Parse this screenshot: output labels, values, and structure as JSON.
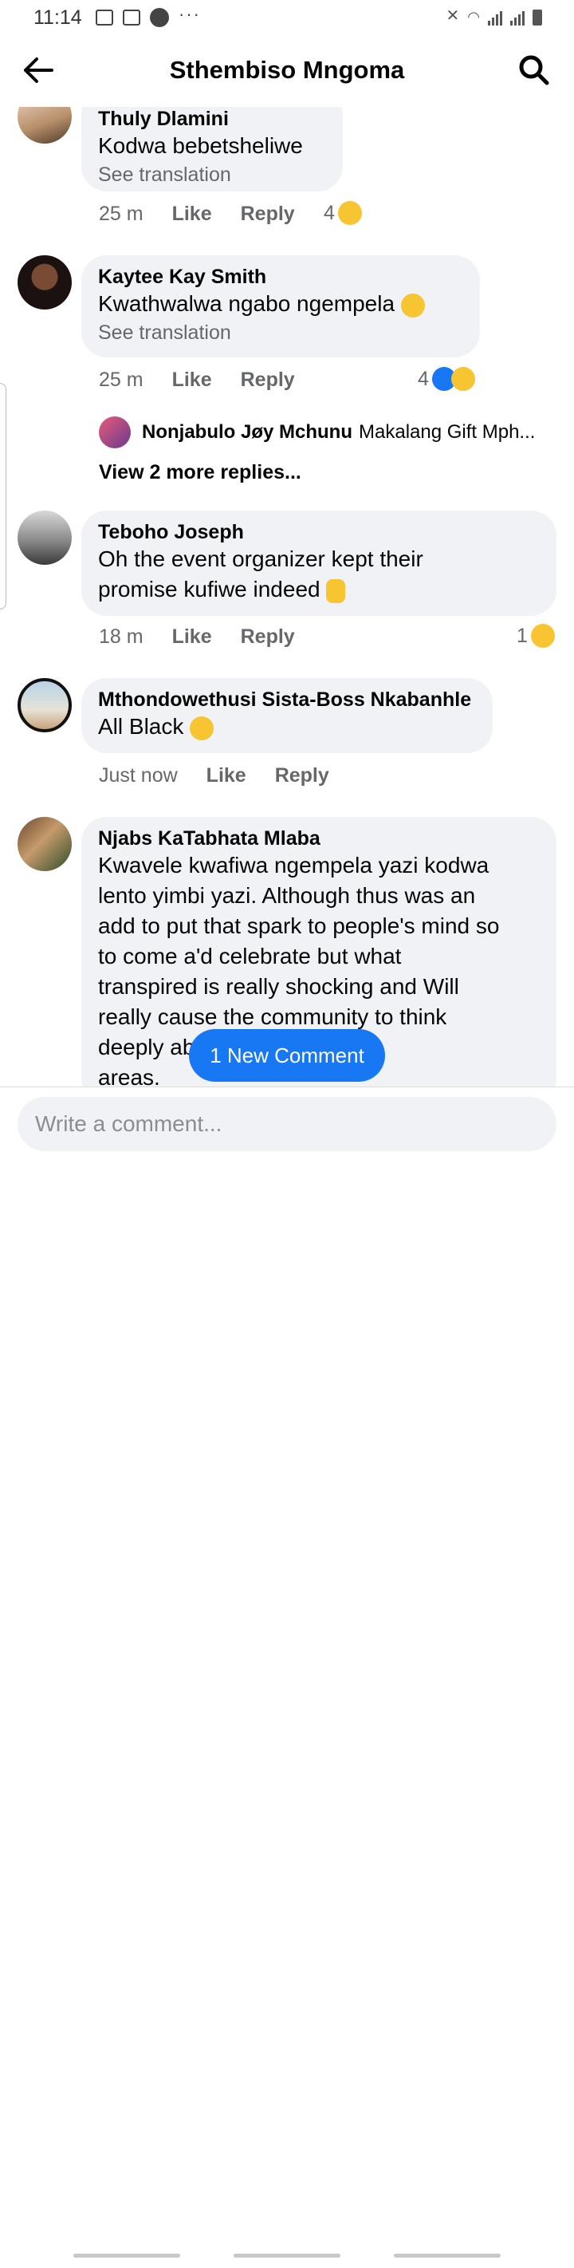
{
  "status": {
    "time": "11:14",
    "more": "···"
  },
  "header": {
    "title": "Sthembiso Mngoma"
  },
  "comments": [
    {
      "name": "Thuly Dlamini",
      "text": "Kodwa bebetsheliwe",
      "translation": "See translation",
      "time": "25 m",
      "like": "Like",
      "reply": "Reply",
      "reaction_count": "4",
      "reaction_icons": [
        "laughing-emoji-icon"
      ]
    },
    {
      "name": "Kaytee Kay Smith",
      "text": "Kwathwalwa ngabo ngempela",
      "translation": "See translation",
      "time": "25 m",
      "like": "Like",
      "reply": "Reply",
      "reaction_count": "4",
      "reaction_icons": [
        "like-reaction-icon",
        "sad-reaction-icon"
      ],
      "reply_preview": {
        "name": "Nonjabulo Jøy Mchunu",
        "text": "Makalang Gift Mph..."
      },
      "view_more": "View 2 more replies..."
    },
    {
      "name": "Teboho Joseph",
      "text_line1": "Oh the event organizer kept their",
      "text_line2": "promise kufiwe indeed",
      "time": "18 m",
      "like": "Like",
      "reply": "Reply",
      "reaction_count": "1",
      "reaction_icons": [
        "sad-reaction-icon"
      ]
    },
    {
      "name": "Mthondowethusi Sista-Boss Nkabanhle",
      "text": "All Black",
      "time": "Just now",
      "like": "Like",
      "reply": "Reply"
    },
    {
      "name": "Njabs KaTabhata Mlaba",
      "lines": [
        "Kwavele kwafiwa ngempela yazi kodwa",
        "lento yimbi yazi. Although thus was an",
        "add to put that spark to people's mind so",
        "to come a'd celebrate but what",
        "transpired is really shocking and Will",
        "really cause the community to think",
        "deeply about entertainment",
        "areas."
      ]
    }
  ],
  "new_comment_pill": "1 New Comment",
  "composer": {
    "placeholder": "Write a comment..."
  },
  "colors": {
    "accent": "#1877f2",
    "bubble": "#f0f2f5",
    "secondary_text": "#65676b"
  }
}
